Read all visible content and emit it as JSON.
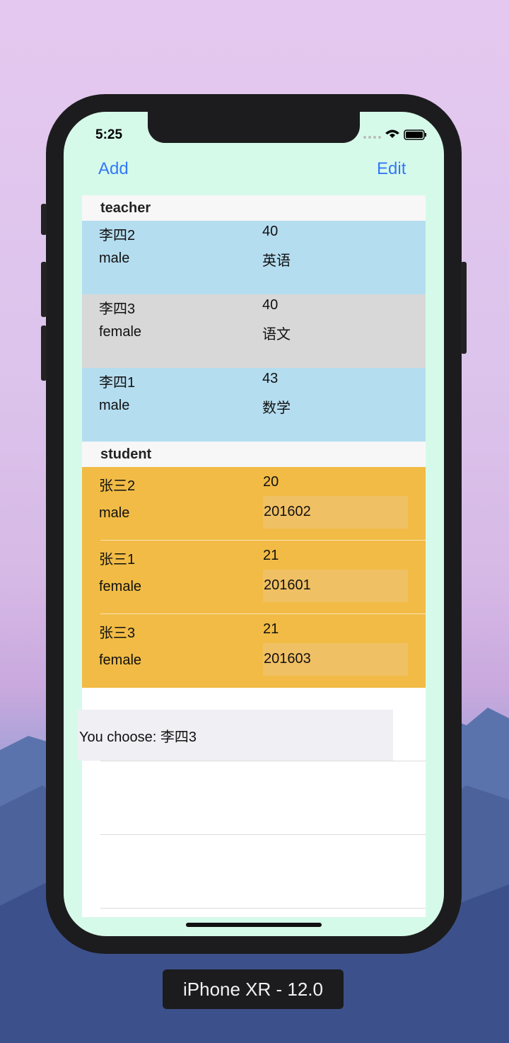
{
  "status_bar": {
    "time": "5:25"
  },
  "nav": {
    "add_label": "Add",
    "edit_label": "Edit"
  },
  "sections": [
    {
      "title": "teacher",
      "rows": [
        {
          "name": "李四2",
          "gender": "male",
          "age": "40",
          "extra": "英语",
          "style": "teacher-blue"
        },
        {
          "name": "李四3",
          "gender": "female",
          "age": "40",
          "extra": "语文",
          "style": "teacher-gray"
        },
        {
          "name": "李四1",
          "gender": "male",
          "age": "43",
          "extra": "数学",
          "style": "teacher-blue"
        }
      ]
    },
    {
      "title": "student",
      "rows": [
        {
          "name": "张三2",
          "gender": "male",
          "age": "20",
          "extra": "201602",
          "style": "student"
        },
        {
          "name": "张三1",
          "gender": "female",
          "age": "21",
          "extra": "201601",
          "style": "student"
        },
        {
          "name": "张三3",
          "gender": "female",
          "age": "21",
          "extra": "201603",
          "style": "student"
        }
      ]
    }
  ],
  "toast": {
    "text": "You choose: 李四3"
  },
  "device_label": "iPhone XR - 12.0",
  "colors": {
    "accent": "#3478f6",
    "teacher_blue": "#b5ddf0",
    "teacher_gray": "#d8d8d8",
    "student_orange": "#f1bb45",
    "screen_bg": "#d6faea"
  }
}
